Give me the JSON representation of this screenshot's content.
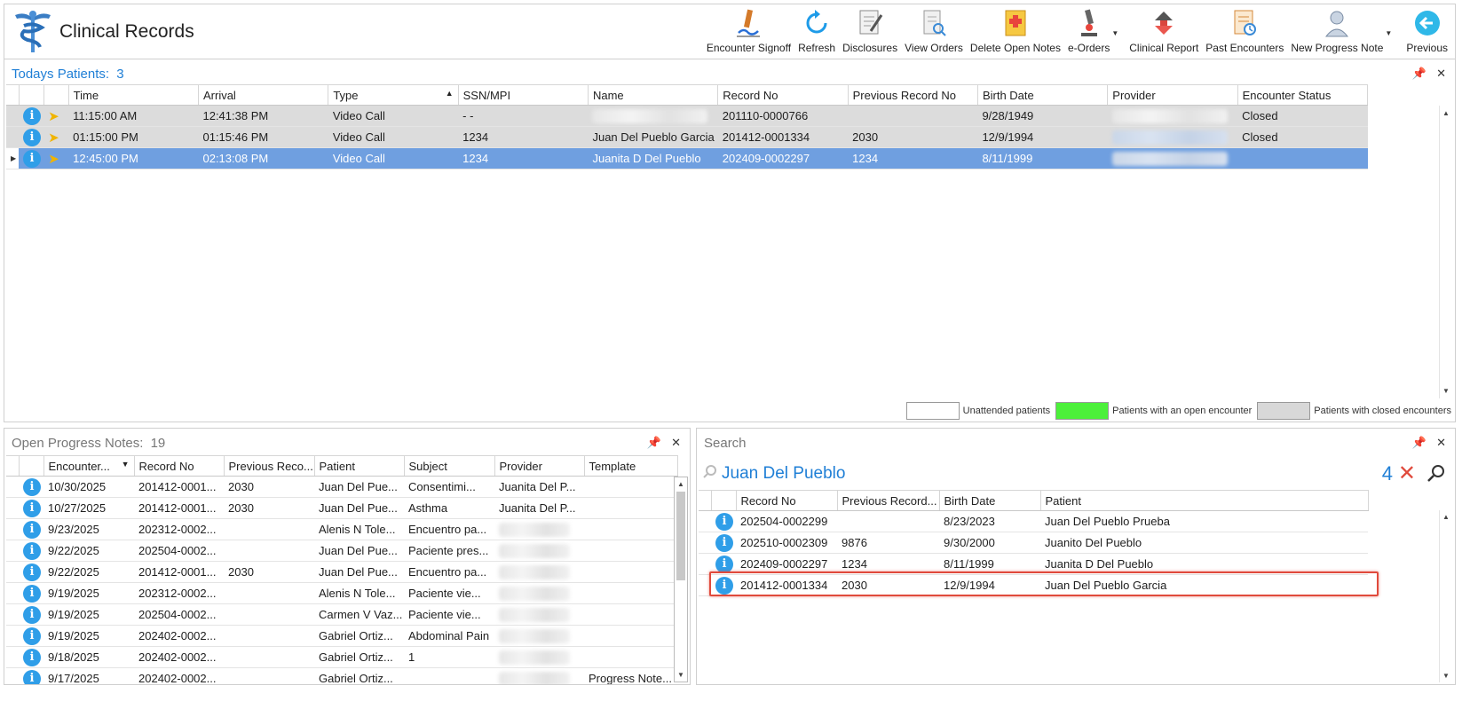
{
  "app": {
    "title": "Clinical Records"
  },
  "toolbar": [
    {
      "label": "Encounter Signoff",
      "icon": "signoff-icon"
    },
    {
      "label": "Refresh",
      "icon": "refresh-icon"
    },
    {
      "label": "Disclosures",
      "icon": "disclosures-icon"
    },
    {
      "label": "View Orders",
      "icon": "view-orders-icon"
    },
    {
      "label": "Delete Open Notes",
      "icon": "delete-notes-icon"
    },
    {
      "label": "e-Orders",
      "icon": "microscope-icon"
    },
    {
      "label": "Clinical Report",
      "icon": "clinical-report-icon"
    },
    {
      "label": "Past Encounters",
      "icon": "past-encounters-icon"
    },
    {
      "label": "New Progress Note",
      "icon": "progress-note-icon"
    },
    {
      "label": "Previous",
      "icon": "previous-icon"
    }
  ],
  "today": {
    "title": "Todays Patients:",
    "count": "3",
    "columns": [
      "Time",
      "Arrival",
      "Type",
      "SSN/MPI",
      "Name",
      "Record No",
      "Previous Record No",
      "Birth Date",
      "Provider",
      "Encounter Status"
    ],
    "rows": [
      {
        "time": "11:15:00 AM",
        "arrival": "12:41:38 PM",
        "type": "Video Call",
        "ssn": "- -",
        "name": "",
        "record": "201110-0000766",
        "prev": "",
        "birth": "9/28/1949",
        "status": "Closed"
      },
      {
        "time": "01:15:00 PM",
        "arrival": "01:15:46 PM",
        "type": "Video Call",
        "ssn": "1234",
        "name": "Juan Del Pueblo Garcia",
        "record": "201412-0001334",
        "prev": "2030",
        "birth": "12/9/1994",
        "status": "Closed"
      },
      {
        "time": "12:45:00 PM",
        "arrival": "02:13:08 PM",
        "type": "Video Call",
        "ssn": "1234",
        "name": "Juanita D Del Pueblo",
        "record": "202409-0002297",
        "prev": "1234",
        "birth": "8/11/1999",
        "status": ""
      }
    ],
    "legend": [
      {
        "label": "Unattended patients",
        "color": "#ffffff"
      },
      {
        "label": "Patients with an open encounter",
        "color": "#4cf03a"
      },
      {
        "label": "Patients with closed encounters",
        "color": "#d8d8d8"
      }
    ]
  },
  "notes": {
    "title": "Open Progress Notes:",
    "count": "19",
    "columns": [
      "Encounter...",
      "Record No",
      "Previous Reco...",
      "Patient",
      "Subject",
      "Provider",
      "Template"
    ],
    "rows": [
      {
        "date": "10/30/2025",
        "record": "201412-0001...",
        "prev": "2030",
        "patient": "Juan Del Pue...",
        "subject": "Consentimi...",
        "provider": "Juanita Del P...",
        "template": ""
      },
      {
        "date": "10/27/2025",
        "record": "201412-0001...",
        "prev": "2030",
        "patient": "Juan Del Pue...",
        "subject": "Asthma",
        "provider": "Juanita Del P...",
        "template": ""
      },
      {
        "date": "9/23/2025",
        "record": "202312-0002...",
        "prev": "",
        "patient": "Alenis N Tole...",
        "subject": "Encuentro pa...",
        "provider": "",
        "template": ""
      },
      {
        "date": "9/22/2025",
        "record": "202504-0002...",
        "prev": "",
        "patient": "Juan Del Pue...",
        "subject": "Paciente pres...",
        "provider": "",
        "template": ""
      },
      {
        "date": "9/22/2025",
        "record": "201412-0001...",
        "prev": "2030",
        "patient": "Juan Del Pue...",
        "subject": "Encuentro pa...",
        "provider": "",
        "template": ""
      },
      {
        "date": "9/19/2025",
        "record": "202312-0002...",
        "prev": "",
        "patient": "Alenis N Tole...",
        "subject": "Paciente vie...",
        "provider": "",
        "template": ""
      },
      {
        "date": "9/19/2025",
        "record": "202504-0002...",
        "prev": "",
        "patient": "Carmen V Vaz...",
        "subject": "Paciente vie...",
        "provider": "",
        "template": ""
      },
      {
        "date": "9/19/2025",
        "record": "202402-0002...",
        "prev": "",
        "patient": "Gabriel Ortiz...",
        "subject": "Abdominal Pain",
        "provider": "",
        "template": ""
      },
      {
        "date": "9/18/2025",
        "record": "202402-0002...",
        "prev": "",
        "patient": "Gabriel Ortiz...",
        "subject": "1",
        "provider": "",
        "template": ""
      },
      {
        "date": "9/17/2025",
        "record": "202402-0002...",
        "prev": "",
        "patient": "Gabriel Ortiz...",
        "subject": "",
        "provider": "",
        "template": "Progress Note..."
      }
    ]
  },
  "search": {
    "title": "Search",
    "query": "Juan Del Pueblo",
    "count": "4",
    "columns": [
      "Record No",
      "Previous Record...",
      "Birth Date",
      "Patient"
    ],
    "rows": [
      {
        "record": "202504-0002299",
        "prev": "",
        "birth": "8/23/2023",
        "patient": "Juan Del Pueblo Prueba"
      },
      {
        "record": "202510-0002309",
        "prev": "9876",
        "birth": "9/30/2000",
        "patient": "Juanito Del Pueblo"
      },
      {
        "record": "202409-0002297",
        "prev": "1234",
        "birth": "8/11/1999",
        "patient": "Juanita D Del Pueblo"
      },
      {
        "record": "201412-0001334",
        "prev": "2030",
        "birth": "12/9/1994",
        "patient": "Juan Del Pueblo Garcia"
      }
    ]
  },
  "colors": {
    "accent": "#1f7fd6",
    "selected": "#6f9fe0",
    "highlight": "#e04a3c",
    "info": "#2f9ee8"
  }
}
